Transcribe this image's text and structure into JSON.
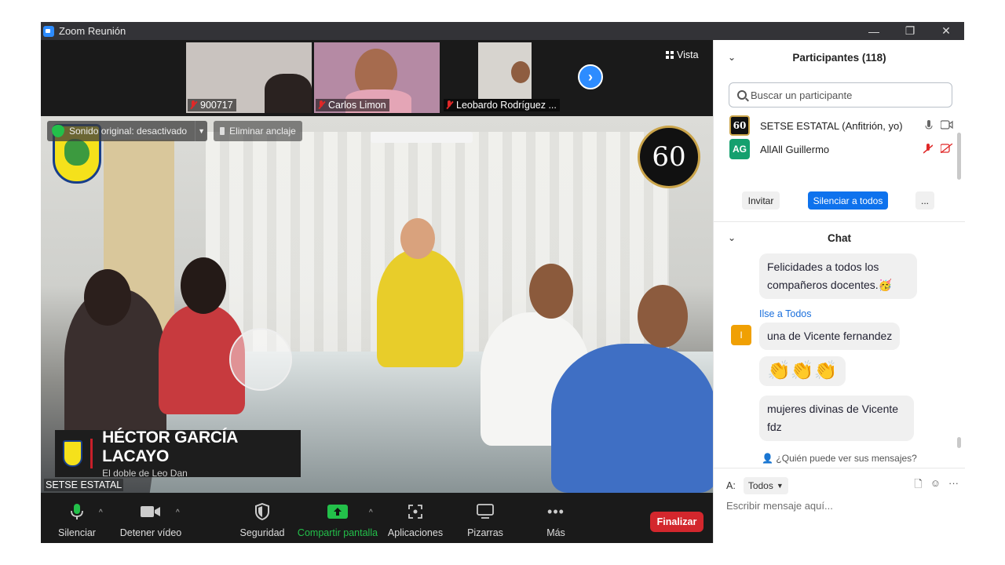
{
  "window": {
    "title": "Zoom Reunión",
    "controls": {
      "minimize": "—",
      "restore": "❐",
      "close": "✕"
    }
  },
  "thumbnails": [
    {
      "name": "900717",
      "muted": true,
      "bg": "#c9c3bf"
    },
    {
      "name": "Carlos Limon",
      "muted": true,
      "bg": "#b58aa4"
    },
    {
      "name": "Leobardo Rodríguez ...",
      "muted": true,
      "bg": "#cfcfcf"
    }
  ],
  "view_button": {
    "label": "Vista",
    "icon": "grid-icon"
  },
  "next_page_icon": "chevron-right-icon",
  "pin_bar": {
    "audio_label": "Sonido original: desactivado",
    "unpin_label": "Eliminar anclaje"
  },
  "anniversary_logo": "60",
  "lower_third": {
    "title": "HÉCTOR GARCÍA LACAYO",
    "subtitle": "El doble de Leo Dan"
  },
  "active_speaker": "SETSE ESTATAL",
  "toolbar": {
    "mute_label": "Silenciar",
    "video_label": "Detener vídeo",
    "security_label": "Seguridad",
    "share_label": "Compartir pantalla",
    "apps_label": "Aplicaciones",
    "whiteboard_label": "Pizarras",
    "more_label": "Más",
    "end_label": "Finalizar"
  },
  "participants_panel": {
    "title": "Participantes (118)",
    "search_placeholder": "Buscar un participante",
    "participants": [
      {
        "name": "SETSE ESTATAL (Anfitrión, yo)",
        "avatar": "60",
        "avatar_color": "#111111"
      },
      {
        "name": "AllAll Guillermo",
        "avatar": "AG",
        "avatar_color": "#14a06e"
      }
    ],
    "invite_label": "Invitar",
    "mute_all_label": "Silenciar a todos",
    "more_label": "..."
  },
  "chat_panel": {
    "title": "Chat",
    "messages": [
      {
        "text": "Felicidades a todos los compañeros docentes.🥳"
      },
      {
        "sender": "Ilse a Todos",
        "avatar": "I",
        "text": "una de Vicente fernandez"
      },
      {
        "text": "👏👏👏"
      },
      {
        "text": "mujeres divinas de Vicente fdz"
      }
    ],
    "who_can_see": "¿Quién puede ver sus mensajes?",
    "to_label": "A:",
    "to_value": "Todos",
    "input_placeholder": "Escribir mensaje aquí..."
  }
}
